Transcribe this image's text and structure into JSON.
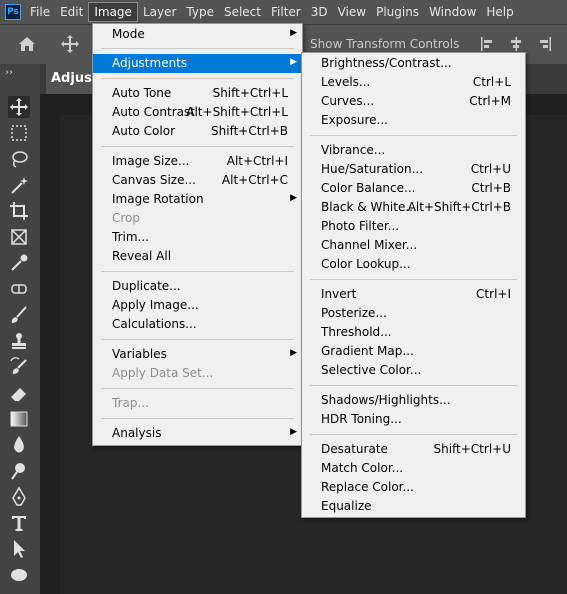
{
  "app": {
    "logo_text": "Ps",
    "accent": "#31a8ff"
  },
  "menubar": [
    "File",
    "Edit",
    "Image",
    "Layer",
    "Type",
    "Select",
    "Filter",
    "3D",
    "View",
    "Plugins",
    "Window",
    "Help"
  ],
  "options_bar": {
    "show_transform_controls": "Show Transform Controls"
  },
  "tab": {
    "label": "Adjust"
  },
  "toolbar_collapse": "››",
  "tools": [
    "move-tool-icon",
    "marquee-tool-icon",
    "lasso-tool-icon",
    "magic-wand-tool-icon",
    "crop-tool-icon",
    "frame-tool-icon",
    "eyedropper-tool-icon",
    "healing-brush-tool-icon",
    "brush-tool-icon",
    "clone-stamp-tool-icon",
    "history-brush-tool-icon",
    "eraser-tool-icon",
    "gradient-tool-icon",
    "blur-tool-icon",
    "dodge-tool-icon",
    "pen-tool-icon",
    "type-tool-icon",
    "path-selection-tool-icon",
    "ellipse-tool-icon"
  ],
  "image_menu": {
    "mode": "Mode",
    "adjustments": "Adjustments",
    "auto_tone": {
      "label": "Auto Tone",
      "shortcut": "Shift+Ctrl+L"
    },
    "auto_contrast": {
      "label": "Auto Contrast",
      "shortcut": "Alt+Shift+Ctrl+L"
    },
    "auto_color": {
      "label": "Auto Color",
      "shortcut": "Shift+Ctrl+B"
    },
    "image_size": {
      "label": "Image Size...",
      "shortcut": "Alt+Ctrl+I"
    },
    "canvas_size": {
      "label": "Canvas Size...",
      "shortcut": "Alt+Ctrl+C"
    },
    "image_rotation": "Image Rotation",
    "crop": "Crop",
    "trim": "Trim...",
    "reveal_all": "Reveal All",
    "duplicate": "Duplicate...",
    "apply_image": "Apply Image...",
    "calculations": "Calculations...",
    "variables": "Variables",
    "apply_data_set": "Apply Data Set...",
    "trap": "Trap...",
    "analysis": "Analysis"
  },
  "adjustments_menu": {
    "brightness_contrast": {
      "label": "Brightness/Contrast...",
      "shortcut": ""
    },
    "levels": {
      "label": "Levels...",
      "shortcut": "Ctrl+L"
    },
    "curves": {
      "label": "Curves...",
      "shortcut": "Ctrl+M"
    },
    "exposure": {
      "label": "Exposure...",
      "shortcut": ""
    },
    "vibrance": {
      "label": "Vibrance...",
      "shortcut": ""
    },
    "hue_saturation": {
      "label": "Hue/Saturation...",
      "shortcut": "Ctrl+U"
    },
    "color_balance": {
      "label": "Color Balance...",
      "shortcut": "Ctrl+B"
    },
    "black_white": {
      "label": "Black & White...",
      "shortcut": "Alt+Shift+Ctrl+B"
    },
    "photo_filter": {
      "label": "Photo Filter...",
      "shortcut": ""
    },
    "channel_mixer": {
      "label": "Channel Mixer...",
      "shortcut": ""
    },
    "color_lookup": {
      "label": "Color Lookup...",
      "shortcut": ""
    },
    "invert": {
      "label": "Invert",
      "shortcut": "Ctrl+I"
    },
    "posterize": {
      "label": "Posterize...",
      "shortcut": ""
    },
    "threshold": {
      "label": "Threshold...",
      "shortcut": ""
    },
    "gradient_map": {
      "label": "Gradient Map...",
      "shortcut": ""
    },
    "selective_color": {
      "label": "Selective Color...",
      "shortcut": ""
    },
    "shadows_highlights": {
      "label": "Shadows/Highlights...",
      "shortcut": ""
    },
    "hdr_toning": {
      "label": "HDR Toning...",
      "shortcut": ""
    },
    "desaturate": {
      "label": "Desaturate",
      "shortcut": "Shift+Ctrl+U"
    },
    "match_color": {
      "label": "Match Color...",
      "shortcut": ""
    },
    "replace_color": {
      "label": "Replace Color...",
      "shortcut": ""
    },
    "equalize": {
      "label": "Equalize",
      "shortcut": ""
    }
  },
  "colors": {
    "menu_bg": "#f0f0f0",
    "highlight": "#0078d7",
    "chrome": "#535353",
    "canvas": "#202020"
  }
}
